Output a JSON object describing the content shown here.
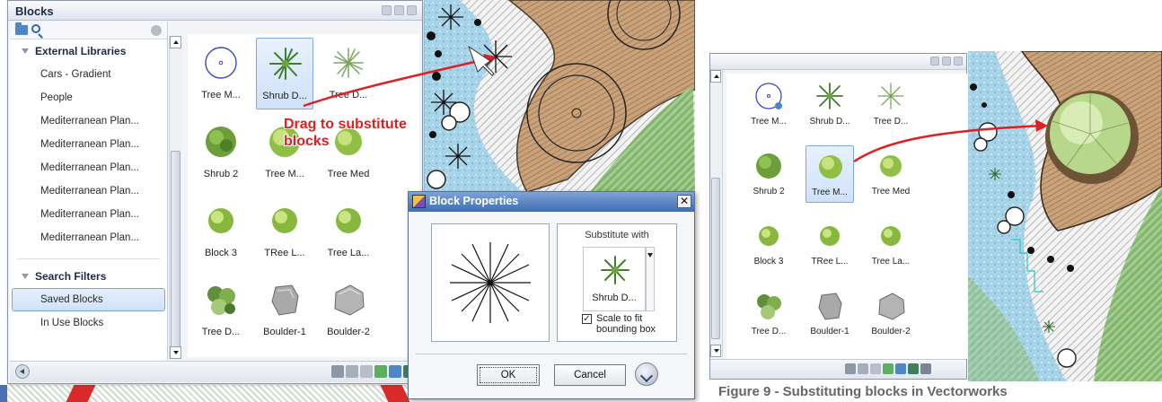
{
  "palette": {
    "title": "Blocks",
    "groups": [
      {
        "label": "External Libraries",
        "items": [
          "Cars - Gradient",
          "People",
          "Mediterranean Plan...",
          "Mediterranean Plan...",
          "Mediterranean Plan...",
          "Mediterranean Plan...",
          "Mediterranean Plan...",
          "Mediterranean Plan..."
        ]
      },
      {
        "label": "Search Filters",
        "items": [
          "Saved Blocks",
          "In Use Blocks"
        ]
      }
    ],
    "selected_filter": "Saved Blocks",
    "blocks": [
      {
        "label": "Tree M...",
        "icon": "tree-outline-icon"
      },
      {
        "label": "Shrub D...",
        "icon": "shrub-spiky-icon",
        "selected": true
      },
      {
        "label": "Tree D...",
        "icon": "tree-palm-icon"
      },
      {
        "label": "Shrub 2",
        "icon": "shrub-round-icon"
      },
      {
        "label": "Tree M...",
        "icon": "tree-round-icon"
      },
      {
        "label": "Tree Med",
        "icon": "tree-round-icon"
      },
      {
        "label": "Block 3",
        "icon": "tree-round-icon"
      },
      {
        "label": "TRee L...",
        "icon": "tree-round-icon"
      },
      {
        "label": "Tree La...",
        "icon": "tree-round-icon"
      },
      {
        "label": "Tree D...",
        "icon": "tree-cluster-icon"
      },
      {
        "label": "Boulder-1",
        "icon": "boulder-icon"
      },
      {
        "label": "Boulder-2",
        "icon": "boulder-icon"
      }
    ]
  },
  "annotation": {
    "line1": "Drag to substitute",
    "line2": "blocks",
    "color": "#e02020"
  },
  "dialog": {
    "title": "Block Properties",
    "substitute_label": "Substitute with",
    "substitute_block": "Shrub D...",
    "scale_checkbox_label": "Scale to fit bounding box",
    "scale_checked": true,
    "ok_label": "OK",
    "cancel_label": "Cancel"
  },
  "palette2": {
    "blocks": [
      {
        "label": "Tree M...",
        "icon": "tree-outline-icon"
      },
      {
        "label": "Shrub D...",
        "icon": "shrub-spiky-icon"
      },
      {
        "label": "Tree D...",
        "icon": "tree-palm-icon"
      },
      {
        "label": "Shrub 2",
        "icon": "shrub-round-icon"
      },
      {
        "label": "Tree M...",
        "icon": "tree-round-icon",
        "selected": true
      },
      {
        "label": "Tree Med",
        "icon": "tree-round-icon"
      },
      {
        "label": "Block 3",
        "icon": "tree-round-icon"
      },
      {
        "label": "TRee L...",
        "icon": "tree-round-icon"
      },
      {
        "label": "Tree La...",
        "icon": "tree-round-icon"
      },
      {
        "label": "Tree D...",
        "icon": "tree-cluster-icon"
      },
      {
        "label": "Boulder-1",
        "icon": "boulder-icon"
      },
      {
        "label": "Boulder-2",
        "icon": "boulder-icon"
      }
    ]
  },
  "caption": "Figure 9 - Substituting blocks in Vectorworks"
}
